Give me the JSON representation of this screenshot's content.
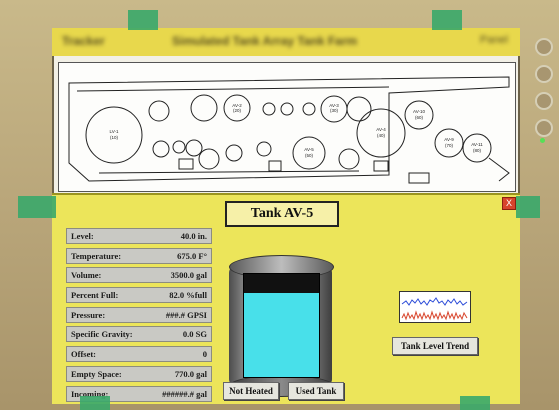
{
  "window": {
    "title": "Tracker",
    "subtitle": "Simulated Tank Array Tank Farm",
    "right_text": "Panel"
  },
  "map": {
    "tank_labels": [
      "LV-1\n(10)",
      "AV-2\n(20)",
      "AV-3\n(30)",
      "AV-4\n(40)",
      "AV-5\n(50)",
      "AV-10\n(60)",
      "AV-9\n(70)",
      "AV-11\n(80)"
    ]
  },
  "panel": {
    "close_label": "X",
    "tank_title": "Tank AV-5",
    "readouts": [
      {
        "label": "Level:",
        "value": "40.0 in."
      },
      {
        "label": "Temperature:",
        "value": "675.0 F°"
      },
      {
        "label": "Volume:",
        "value": "3500.0 gal"
      },
      {
        "label": "Percent Full:",
        "value": "82.0 %full"
      },
      {
        "label": "Pressure:",
        "value": "###.# GPSI"
      },
      {
        "label": "Specific Gravity:",
        "value": "0.0 SG"
      },
      {
        "label": "Offset:",
        "value": "0"
      },
      {
        "label": "Empty Space:",
        "value": "770.0 gal"
      },
      {
        "label": "Incoming:",
        "value": "######.# gal"
      }
    ],
    "fill_percent": 82,
    "buttons": {
      "not_heated": "Not Heated",
      "used_tank": "Used Tank",
      "trend": "Tank Level Trend"
    }
  },
  "colors": {
    "panel_bg": "#ece55a",
    "fluid": "#48e0ea",
    "close": "#d8452c"
  }
}
